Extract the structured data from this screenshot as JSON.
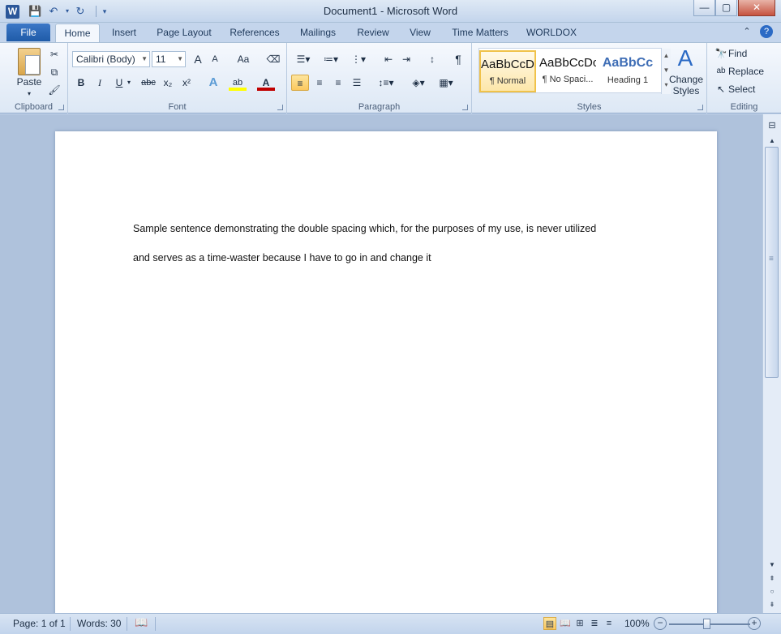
{
  "window": {
    "title": "Document1  -  Microsoft Word",
    "app_icon": "W",
    "qat": [
      "save-icon",
      "undo-icon",
      "redo-icon",
      "customize-icon"
    ]
  },
  "tabs": {
    "file": "File",
    "items": [
      "Home",
      "Insert",
      "Page Layout",
      "References",
      "Mailings",
      "Review",
      "View",
      "Time Matters",
      "WORLDOX"
    ],
    "active": "Home"
  },
  "ribbon": {
    "clipboard": {
      "label": "Clipboard",
      "paste": "Paste"
    },
    "font": {
      "label": "Font",
      "family": "Calibri (Body)",
      "size": "11",
      "grow": "A",
      "shrink": "A",
      "case": "Aa",
      "bold": "B",
      "italic": "I",
      "underline": "U",
      "strike": "abc",
      "subscript": "x₂",
      "superscript": "x²",
      "effects": "A",
      "highlight": "ab",
      "color": "A",
      "font_color": "#c00000",
      "highlight_color": "#ffff00"
    },
    "paragraph": {
      "label": "Paragraph",
      "pilcrow": "¶"
    },
    "styles": {
      "label": "Styles",
      "items": [
        {
          "sample": "AaBbCcDc",
          "name": "¶ Normal"
        },
        {
          "sample": "AaBbCcDc",
          "name": "¶ No Spaci..."
        },
        {
          "sample": "AaBbCc",
          "name": "Heading 1"
        }
      ],
      "change_line1": "Change",
      "change_line2": "Styles"
    },
    "editing": {
      "label": "Editing",
      "find": "Find",
      "replace": "Replace",
      "select": "Select"
    }
  },
  "document": {
    "line1": "Sample sentence demonstrating the double spacing which, for the purposes of my use, is never utilized",
    "line2": "and serves as a time-waster because I have to go in  and change it"
  },
  "status": {
    "page": "Page: 1 of 1",
    "words": "Words: 30",
    "zoom": "100%"
  },
  "colors": {
    "accent": "#2b579a",
    "selected": "#fcc85e"
  }
}
